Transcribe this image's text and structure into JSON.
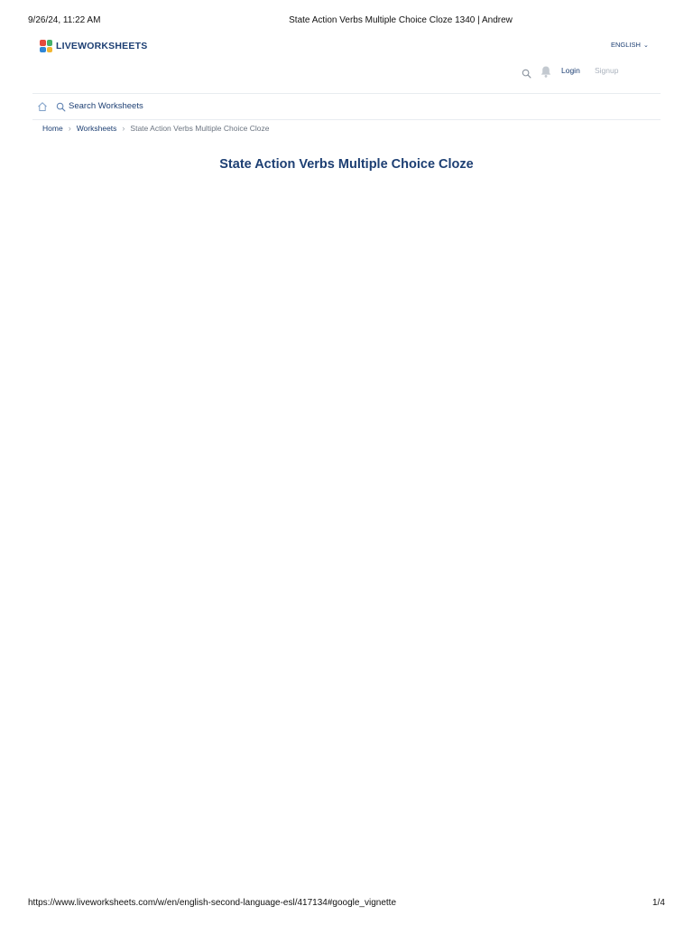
{
  "print": {
    "date": "9/26/24, 11:22 AM",
    "title": "State Action Verbs Multiple Choice Cloze 1340 | Andrew",
    "url": "https://www.liveworksheets.com/w/en/english-second-language-esl/417134#google_vignette",
    "page": "1/4"
  },
  "header": {
    "logo_text": "LIVEWORKSHEETS",
    "language": "ENGLISH",
    "login": "Login",
    "signup": "Signup"
  },
  "nav": {
    "search_label": "Search Worksheets"
  },
  "breadcrumb": {
    "items": [
      "Home",
      "Worksheets"
    ],
    "current": "State Action Verbs Multiple Choice Cloze"
  },
  "main": {
    "title": "State Action Verbs Multiple Choice Cloze"
  },
  "colors": {
    "brand_navy": "#1d3f73",
    "muted": "#aab2bd",
    "logo_red": "#e54b3c",
    "logo_green": "#46b06a",
    "logo_blue": "#2f86d6",
    "logo_yellow": "#f2b631"
  }
}
